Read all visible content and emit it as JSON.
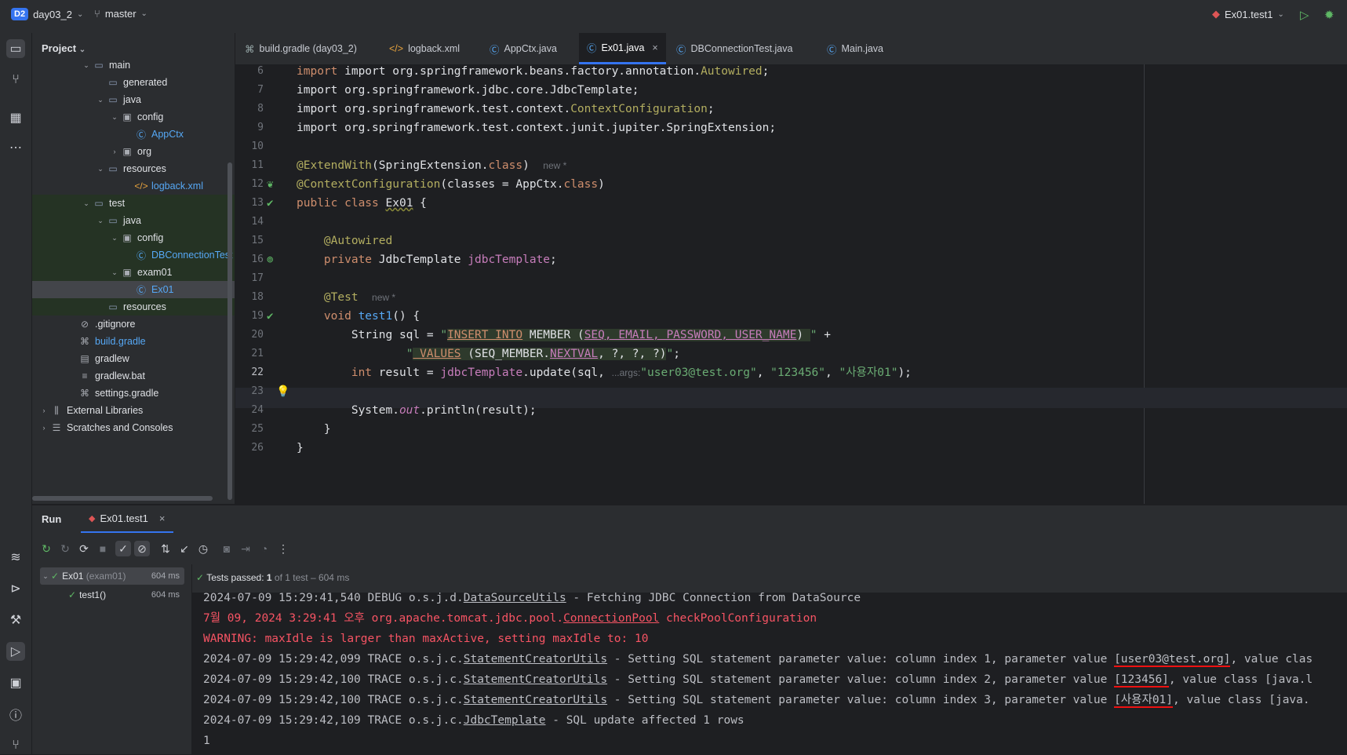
{
  "topbar": {
    "project_badge": "D2",
    "project_name": "day03_2",
    "branch": "master",
    "run_config": "Ex01.test1"
  },
  "project_panel": {
    "title": "Project",
    "tree": [
      {
        "label": "main",
        "indent": 3,
        "arrow": "v",
        "icon": "folder-icon"
      },
      {
        "label": "generated",
        "indent": 4,
        "arrow": "",
        "icon": "folder-icon"
      },
      {
        "label": "java",
        "indent": 4,
        "arrow": "v",
        "icon": "folder-icon"
      },
      {
        "label": "config",
        "indent": 5,
        "arrow": "v",
        "icon": "package-icon"
      },
      {
        "label": "AppCtx",
        "indent": 6,
        "arrow": "",
        "icon": "class-icon",
        "color": "#56a8f5"
      },
      {
        "label": "org",
        "indent": 5,
        "arrow": ">",
        "icon": "package-icon"
      },
      {
        "label": "resources",
        "indent": 4,
        "arrow": "v",
        "icon": "folder-icon"
      },
      {
        "label": "logback.xml",
        "indent": 6,
        "arrow": "",
        "icon": "xml-icon",
        "color": "#56a8f5"
      },
      {
        "label": "test",
        "indent": 3,
        "arrow": "v",
        "icon": "folder-icon",
        "green": true
      },
      {
        "label": "java",
        "indent": 4,
        "arrow": "v",
        "icon": "folder-icon",
        "green": true
      },
      {
        "label": "config",
        "indent": 5,
        "arrow": "v",
        "icon": "package-icon",
        "green": true
      },
      {
        "label": "DBConnectionTest",
        "indent": 6,
        "arrow": "",
        "icon": "class-icon",
        "color": "#56a8f5",
        "green": true
      },
      {
        "label": "exam01",
        "indent": 5,
        "arrow": "v",
        "icon": "package-icon",
        "green": true
      },
      {
        "label": "Ex01",
        "indent": 6,
        "arrow": "",
        "icon": "class-icon",
        "color": "#56a8f5",
        "selected": true
      },
      {
        "label": "resources",
        "indent": 4,
        "arrow": "",
        "icon": "folder-icon",
        "green": true
      },
      {
        "label": ".gitignore",
        "indent": 2,
        "arrow": "",
        "icon": "ignore-icon"
      },
      {
        "label": "build.gradle",
        "indent": 2,
        "arrow": "",
        "icon": "gradle-icon",
        "color": "#56a8f5"
      },
      {
        "label": "gradlew",
        "indent": 2,
        "arrow": "",
        "icon": "file-icon"
      },
      {
        "label": "gradlew.bat",
        "indent": 2,
        "arrow": "",
        "icon": "lines-icon"
      },
      {
        "label": "settings.gradle",
        "indent": 2,
        "arrow": "",
        "icon": "gradle-icon"
      },
      {
        "label": "External Libraries",
        "indent": 0,
        "arrow": ">",
        "icon": "library-icon"
      },
      {
        "label": "Scratches and Consoles",
        "indent": 0,
        "arrow": ">",
        "icon": "scratch-icon"
      }
    ]
  },
  "tabs": [
    {
      "label": "build.gradle (day03_2)",
      "icon": "gradle-icon"
    },
    {
      "label": "logback.xml",
      "icon": "xml-icon"
    },
    {
      "label": "AppCtx.java",
      "icon": "class-icon"
    },
    {
      "label": "Ex01.java",
      "icon": "class-icon",
      "active": true
    },
    {
      "label": "DBConnectionTest.java",
      "icon": "class-icon"
    },
    {
      "label": "Main.java",
      "icon": "class-icon"
    }
  ],
  "editor": {
    "line_numbers": [
      "6",
      "7",
      "8",
      "9",
      "10",
      "11",
      "12",
      "13",
      "14",
      "15",
      "16",
      "17",
      "18",
      "19",
      "20",
      "21",
      "22",
      "23",
      "24",
      "25",
      "26"
    ],
    "code": {
      "l6_a": "import org.springframework.beans.factory.annotation.",
      "l6_b": "Autowired",
      "l6_c": ";",
      "l7": "import org.springframework.jdbc.core.JdbcTemplate;",
      "l8_a": "import org.springframework.test.context.",
      "l8_b": "ContextConfiguration",
      "l8_c": ";",
      "l9": "import org.springframework.test.context.junit.jupiter.SpringExtension;",
      "l11_a": "@ExtendWith",
      "l11_b": "(SpringExtension.",
      "l11_c": "class",
      "l11_d": ")",
      "l11_hint": "new *",
      "l12_a": "@ContextConfiguration",
      "l12_b": "(classes = AppCtx.",
      "l12_c": "class",
      "l12_d": ")",
      "l13_a": "public class ",
      "l13_b": "Ex01",
      "l13_c": " {",
      "l15": "@Autowired",
      "l16_a": "private ",
      "l16_b": "JdbcTemplate ",
      "l16_c": "jdbcTemplate",
      "l16_d": ";",
      "l18_a": "@Test",
      "l18_hint": "new *",
      "l19_a": "void ",
      "l19_b": "test1",
      "l19_c": "() {",
      "l20_a": "String sql = ",
      "l20_q": "\"",
      "l20_b": "INSERT INTO",
      "l20_c": " MEMBER (",
      "l20_d": "SEQ, EMAIL, PASSWORD, USER_NAME",
      "l20_e": ") ",
      "l20_f": "\"",
      "l20_g": " +",
      "l21_q": "\"",
      "l21_b": " VALUES",
      "l21_c": " (SEQ_MEMBER.",
      "l21_d": "NEXTVAL",
      "l21_e": ", ?, ?, ?)",
      "l21_f": "\"",
      "l21_g": ";",
      "l22_a": "int ",
      "l22_b": "result = ",
      "l22_c": "jdbcTemplate",
      "l22_d": ".update(sql, ",
      "l22_hint": "...args:",
      "l22_e": "\"user03@test.org\"",
      "l22_f": ", ",
      "l22_g": "\"123456\"",
      "l22_h": ", ",
      "l22_i": "\"사용자01\"",
      "l22_j": ");",
      "l24_a": "System.",
      "l24_b": "out",
      "l24_c": ".println(result);",
      "l25": "}",
      "l26": "}"
    }
  },
  "run": {
    "tab_label": "Run",
    "config_tab": "Ex01.test1",
    "status": "Tests passed: ",
    "status_count": "1",
    "status_rest": " of 1 test – 604 ms",
    "tests": [
      {
        "label": "Ex01",
        "sub": "(exam01)",
        "time": "604 ms"
      },
      {
        "label": "test1()",
        "sub": "",
        "time": "604 ms"
      }
    ],
    "console": {
      "c1_a": "2024-07-09 15:29:41,540 DEBUG o.s.j.d.",
      "c1_b": "DataSourceUtils",
      "c1_c": " - Fetching JDBC Connection from DataSource",
      "c2_a": "7월 09, 2024 3:29:41 오후 org.apache.tomcat.jdbc.pool.",
      "c2_b": "ConnectionPool",
      "c2_c": " checkPoolConfiguration",
      "c3": "WARNING: maxIdle is larger than maxActive, setting maxIdle to: 10",
      "c4_a": "2024-07-09 15:29:42,099 TRACE o.s.j.c.",
      "c4_b": "StatementCreatorUtils",
      "c4_c": " - Setting SQL statement parameter value: column index 1, parameter value ",
      "c4_d": "[user03@test.org]",
      "c4_e": ", value clas",
      "c5_a": "2024-07-09 15:29:42,100 TRACE o.s.j.c.",
      "c5_b": "StatementCreatorUtils",
      "c5_c": " - Setting SQL statement parameter value: column index 2, parameter value ",
      "c5_d": "[123456]",
      "c5_e": ", value class [java.l",
      "c6_a": "2024-07-09 15:29:42,100 TRACE o.s.j.c.",
      "c6_b": "StatementCreatorUtils",
      "c6_c": " - Setting SQL statement parameter value: column index 3, parameter value ",
      "c6_d": "[사용자01]",
      "c6_e": ", value class [java.",
      "c7_a": "2024-07-09 15:29:42,109 TRACE o.s.j.c.",
      "c7_b": "JdbcTemplate",
      "c7_c": " - SQL update affected 1 rows",
      "c8": "1"
    }
  }
}
